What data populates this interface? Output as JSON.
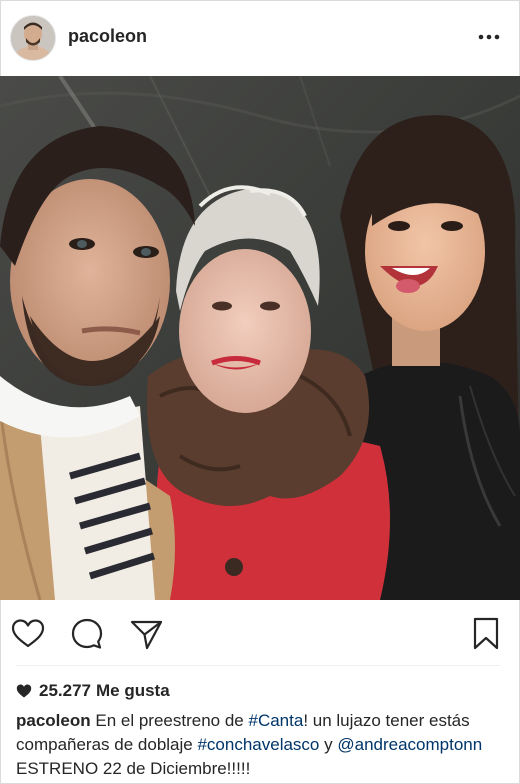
{
  "post": {
    "username": "pacoleon",
    "likes_count": "25.277",
    "likes_label": "Me gusta"
  },
  "caption": {
    "username": "pacoleon",
    "text_1": "En el preestreno de",
    "hashtag_canta": "#Canta",
    "text_2": "!  un lujazo tener estás compañeras de doblaje",
    "hashtag_concha": "#conchavelasco",
    "text_3": "y",
    "mention": "@andreacomptonn",
    "text_4": "ESTRENO 22 de Diciembre!!!!!"
  },
  "icons": {
    "avatar": "avatar",
    "more": "more-options-icon",
    "like": "heart-icon",
    "comment": "comment-icon",
    "share": "share-icon",
    "save": "bookmark-icon",
    "likes_heart": "heart-filled-icon"
  },
  "colors": {
    "text": "#262626",
    "link": "#003569",
    "border": "#dbdbdb"
  }
}
